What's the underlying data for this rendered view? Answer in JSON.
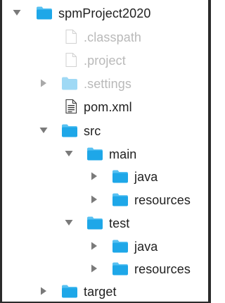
{
  "tree": {
    "items": [
      {
        "label": "spmProject2020",
        "type": "folder",
        "expanded": true,
        "dimmed": false,
        "depth": 0
      },
      {
        "label": ".classpath",
        "type": "file",
        "dimmed": true,
        "depth": 1
      },
      {
        "label": ".project",
        "type": "file",
        "dimmed": true,
        "depth": 1
      },
      {
        "label": ".settings",
        "type": "folder",
        "expanded": false,
        "dimmed": true,
        "depth": 1
      },
      {
        "label": "pom.xml",
        "type": "xml-file",
        "dimmed": false,
        "depth": 1
      },
      {
        "label": "src",
        "type": "folder",
        "expanded": true,
        "dimmed": false,
        "depth": 1
      },
      {
        "label": "main",
        "type": "folder",
        "expanded": true,
        "dimmed": false,
        "depth": 2
      },
      {
        "label": "java",
        "type": "folder",
        "expanded": false,
        "dimmed": false,
        "depth": 3
      },
      {
        "label": "resources",
        "type": "folder",
        "expanded": false,
        "dimmed": false,
        "depth": 3
      },
      {
        "label": "test",
        "type": "folder",
        "expanded": true,
        "dimmed": false,
        "depth": 2
      },
      {
        "label": "java",
        "type": "folder",
        "expanded": false,
        "dimmed": false,
        "depth": 3
      },
      {
        "label": "resources",
        "type": "folder",
        "expanded": false,
        "dimmed": false,
        "depth": 3
      },
      {
        "label": "target",
        "type": "folder",
        "expanded": false,
        "dimmed": false,
        "depth": 1
      }
    ]
  },
  "colors": {
    "folder": "#1ea7e8",
    "folder_tab": "#57c1f2",
    "folder_dim": "#9fd9f5",
    "chevron": "#7a7a7a",
    "text": "#1f1f1f",
    "text_dim": "#b9b9b9"
  },
  "icons": {
    "folder": "folder-icon",
    "file": "file-icon",
    "xml-file": "xml-file-icon",
    "expanded": "chevron-down-icon",
    "collapsed": "chevron-right-icon"
  }
}
